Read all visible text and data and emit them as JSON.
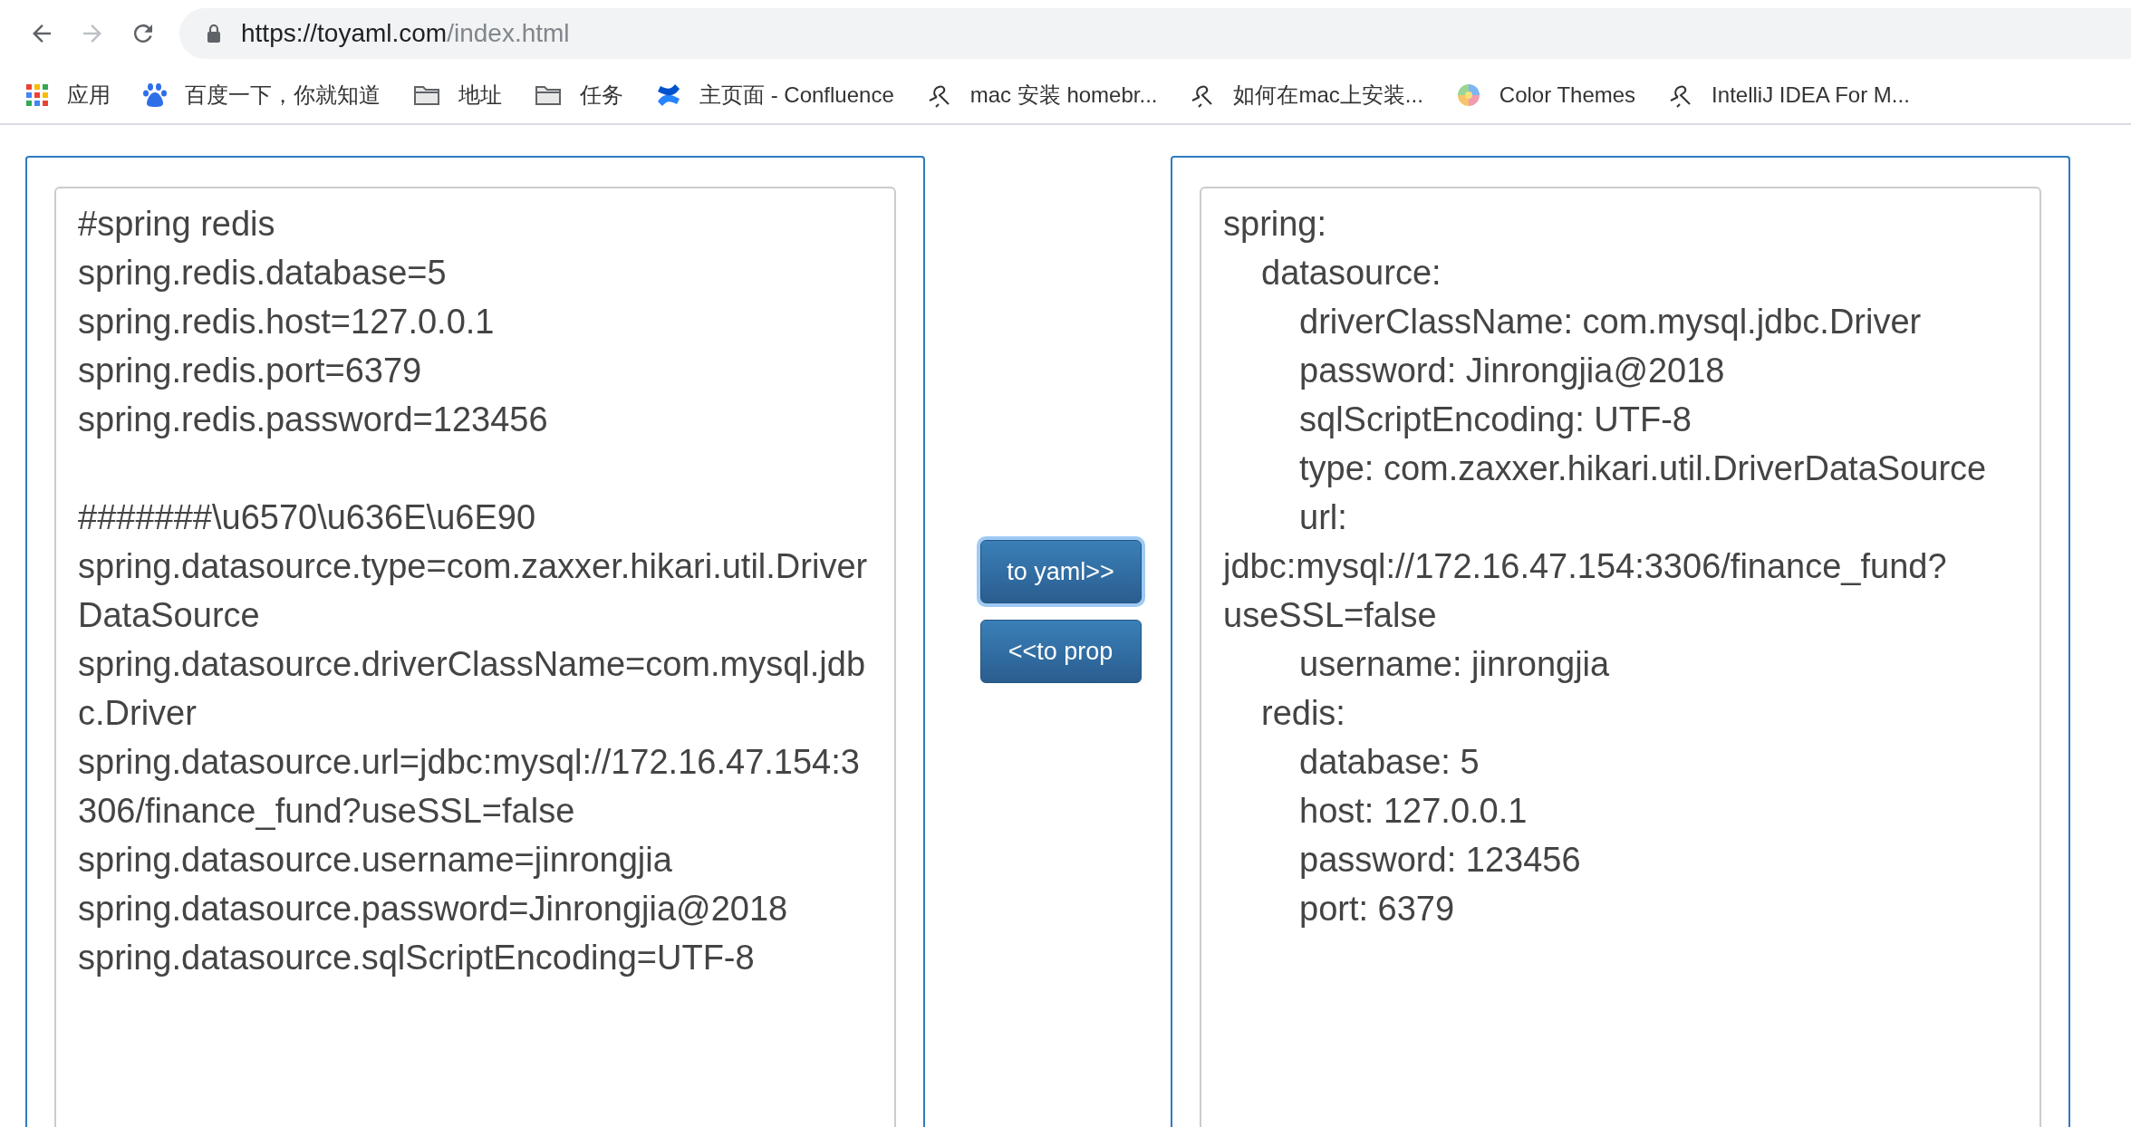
{
  "browser": {
    "back_enabled": true,
    "forward_enabled": false,
    "url_host": "https://toyaml.com",
    "url_path": "/index.html"
  },
  "bookmarks": [
    {
      "kind": "apps",
      "label": "应用"
    },
    {
      "kind": "baidu",
      "label": "百度一下，你就知道"
    },
    {
      "kind": "folder",
      "label": "地址"
    },
    {
      "kind": "folder",
      "label": "任务"
    },
    {
      "kind": "confluence",
      "label": "主页面 - Confluence"
    },
    {
      "kind": "yuque",
      "label": "mac 安装 homebr..."
    },
    {
      "kind": "yuque",
      "label": "如何在mac上安装..."
    },
    {
      "kind": "colors",
      "label": "Color Themes"
    },
    {
      "kind": "yuque",
      "label": "IntelliJ IDEA For M..."
    }
  ],
  "properties_blocks": [
    [
      "#spring redis",
      "spring.redis.database=5",
      "spring.redis.host=127.0.0.1",
      "spring.redis.port=6379",
      "spring.redis.password=123456"
    ],
    [
      "#######\\u6570\\u636E\\u6E90",
      "spring.datasource.type=com.zaxxer.hikari.util.DriverDataSource",
      "spring.datasource.driverClassName=com.mysql.jdbc.Driver",
      "spring.datasource.url=jdbc:mysql://172.16.47.154:3306/finance_fund?useSSL=false",
      "spring.datasource.username=jinrongjia",
      "spring.datasource.password=Jinrongjia@2018",
      "spring.datasource.sqlScriptEncoding=UTF-8"
    ]
  ],
  "buttons": [
    {
      "label": "to yaml>>",
      "focused": true
    },
    {
      "label": "<<to prop",
      "focused": false
    }
  ],
  "yaml": [
    {
      "text": "spring:",
      "children": [
        {
          "text": "datasource:",
          "children": [
            {
              "text": "driverClassName: com.mysql.jdbc.Driver"
            },
            {
              "text": "password: Jinrongjia@2018"
            },
            {
              "text": "sqlScriptEncoding: UTF-8"
            },
            {
              "text": "type: com.zaxxer.hikari.util.DriverDataSource"
            },
            {
              "text": "url: jdbc:mysql://172.16.47.154:3306/finance_fund?useSSL=false"
            },
            {
              "text": "username: jinrongjia"
            }
          ]
        },
        {
          "text": "redis:",
          "children": [
            {
              "text": "database: 5"
            },
            {
              "text": "host: 127.0.0.1"
            },
            {
              "text": "password: 123456"
            },
            {
              "text": "port: 6379"
            }
          ]
        }
      ]
    }
  ]
}
